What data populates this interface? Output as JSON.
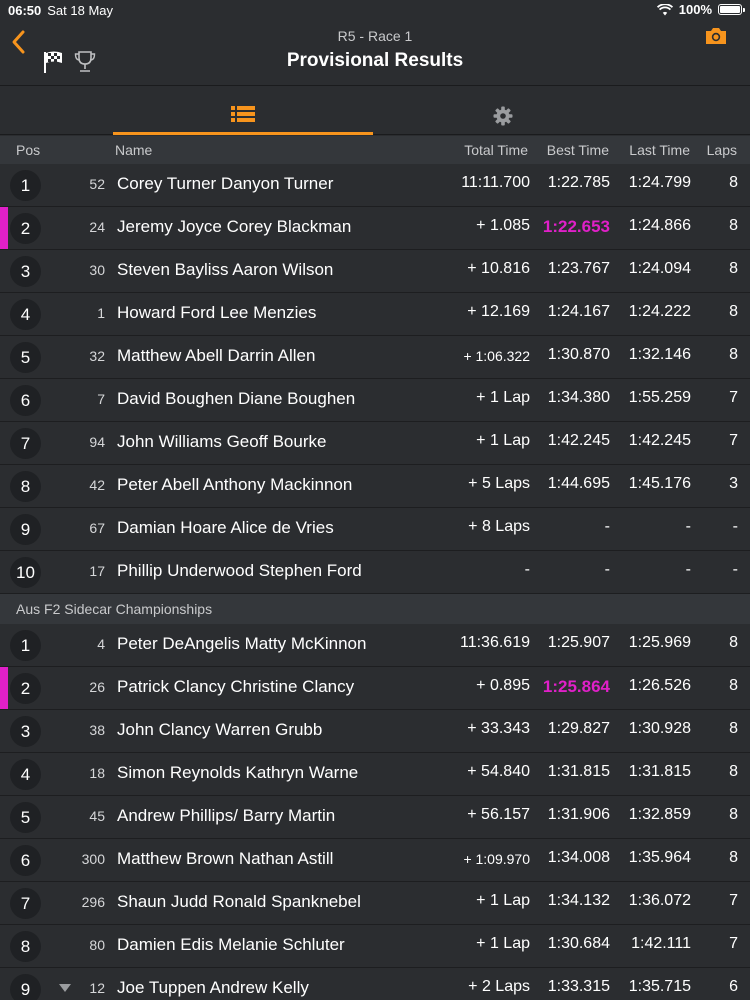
{
  "status_bar": {
    "time": "06:50",
    "date": "Sat 18 May",
    "battery": "100%"
  },
  "header": {
    "subtitle": "R5 - Race 1",
    "title": "Provisional Results"
  },
  "tabs": [
    {
      "name": "results-list",
      "icon": "list-icon",
      "active": true
    },
    {
      "name": "settings",
      "icon": "gear-icon",
      "active": false
    }
  ],
  "columns": {
    "pos": "Pos",
    "name": "Name",
    "total": "Total Time",
    "best": "Best Time",
    "last": "Last Time",
    "laps": "Laps"
  },
  "colors": {
    "accent": "#f7941d",
    "fastest": "#e020c8",
    "background": "#2b2d30"
  },
  "groups": [
    {
      "title": "",
      "rows": [
        {
          "pos": "1",
          "num": "52",
          "name": "Corey Turner Danyon Turner",
          "total": "11:11.700",
          "best": "1:22.785",
          "last": "1:24.799",
          "laps": "8"
        },
        {
          "pos": "2",
          "num": "24",
          "name": "Jeremy Joyce Corey Blackman",
          "total": "+ 1.085",
          "best": "1:22.653",
          "last": "1:24.866",
          "laps": "8",
          "fastest": true
        },
        {
          "pos": "3",
          "num": "30",
          "name": "Steven Bayliss Aaron Wilson",
          "total": "+ 10.816",
          "best": "1:23.767",
          "last": "1:24.094",
          "laps": "8"
        },
        {
          "pos": "4",
          "num": "1",
          "name": "Howard Ford Lee Menzies",
          "total": "+ 12.169",
          "best": "1:24.167",
          "last": "1:24.222",
          "laps": "8"
        },
        {
          "pos": "5",
          "num": "32",
          "name": "Matthew Abell Darrin Allen",
          "total": "+ 1:06.322",
          "best": "1:30.870",
          "last": "1:32.146",
          "laps": "8",
          "small": true
        },
        {
          "pos": "6",
          "num": "7",
          "name": "David Boughen Diane Boughen",
          "total": "+ 1 Lap",
          "best": "1:34.380",
          "last": "1:55.259",
          "laps": "7"
        },
        {
          "pos": "7",
          "num": "94",
          "name": "John Williams Geoff Bourke",
          "total": "+ 1 Lap",
          "best": "1:42.245",
          "last": "1:42.245",
          "laps": "7"
        },
        {
          "pos": "8",
          "num": "42",
          "name": "Peter Abell Anthony Mackinnon",
          "total": "+ 5 Laps",
          "best": "1:44.695",
          "last": "1:45.176",
          "laps": "3"
        },
        {
          "pos": "9",
          "num": "67",
          "name": "Damian Hoare Alice de Vries",
          "total": "+ 8 Laps",
          "best": "-",
          "last": "-",
          "laps": "-"
        },
        {
          "pos": "10",
          "num": "17",
          "name": "Phillip Underwood Stephen Ford",
          "total": "-",
          "best": "-",
          "last": "-",
          "laps": "-"
        }
      ]
    },
    {
      "title": "Aus F2 Sidecar Championships",
      "rows": [
        {
          "pos": "1",
          "num": "4",
          "name": "Peter DeAngelis Matty McKinnon",
          "total": "11:36.619",
          "best": "1:25.907",
          "last": "1:25.969",
          "laps": "8"
        },
        {
          "pos": "2",
          "num": "26",
          "name": "Patrick Clancy Christine Clancy",
          "total": "+ 0.895",
          "best": "1:25.864",
          "last": "1:26.526",
          "laps": "8",
          "fastest": true
        },
        {
          "pos": "3",
          "num": "38",
          "name": "John Clancy Warren Grubb",
          "total": "+ 33.343",
          "best": "1:29.827",
          "last": "1:30.928",
          "laps": "8"
        },
        {
          "pos": "4",
          "num": "18",
          "name": "Simon Reynolds Kathryn Warne",
          "total": "+ 54.840",
          "best": "1:31.815",
          "last": "1:31.815",
          "laps": "8"
        },
        {
          "pos": "5",
          "num": "45",
          "name": "Andrew Phillips/ Barry Martin",
          "total": "+ 56.157",
          "best": "1:31.906",
          "last": "1:32.859",
          "laps": "8"
        },
        {
          "pos": "6",
          "num": "300",
          "name": "Matthew Brown Nathan Astill",
          "total": "+ 1:09.970",
          "best": "1:34.008",
          "last": "1:35.964",
          "laps": "8",
          "small": true
        },
        {
          "pos": "7",
          "num": "296",
          "name": "Shaun Judd Ronald Spanknebel",
          "total": "+ 1 Lap",
          "best": "1:34.132",
          "last": "1:36.072",
          "laps": "7"
        },
        {
          "pos": "8",
          "num": "80",
          "name": "Damien Edis Melanie Schluter",
          "total": "+ 1 Lap",
          "best": "1:30.684",
          "last": "1:42.111",
          "laps": "7"
        },
        {
          "pos": "9",
          "num": "12",
          "name": "Joe Tuppen Andrew Kelly",
          "total": "+ 2 Laps",
          "best": "1:33.315",
          "last": "1:35.715",
          "laps": "6",
          "trend": "down"
        }
      ]
    }
  ]
}
